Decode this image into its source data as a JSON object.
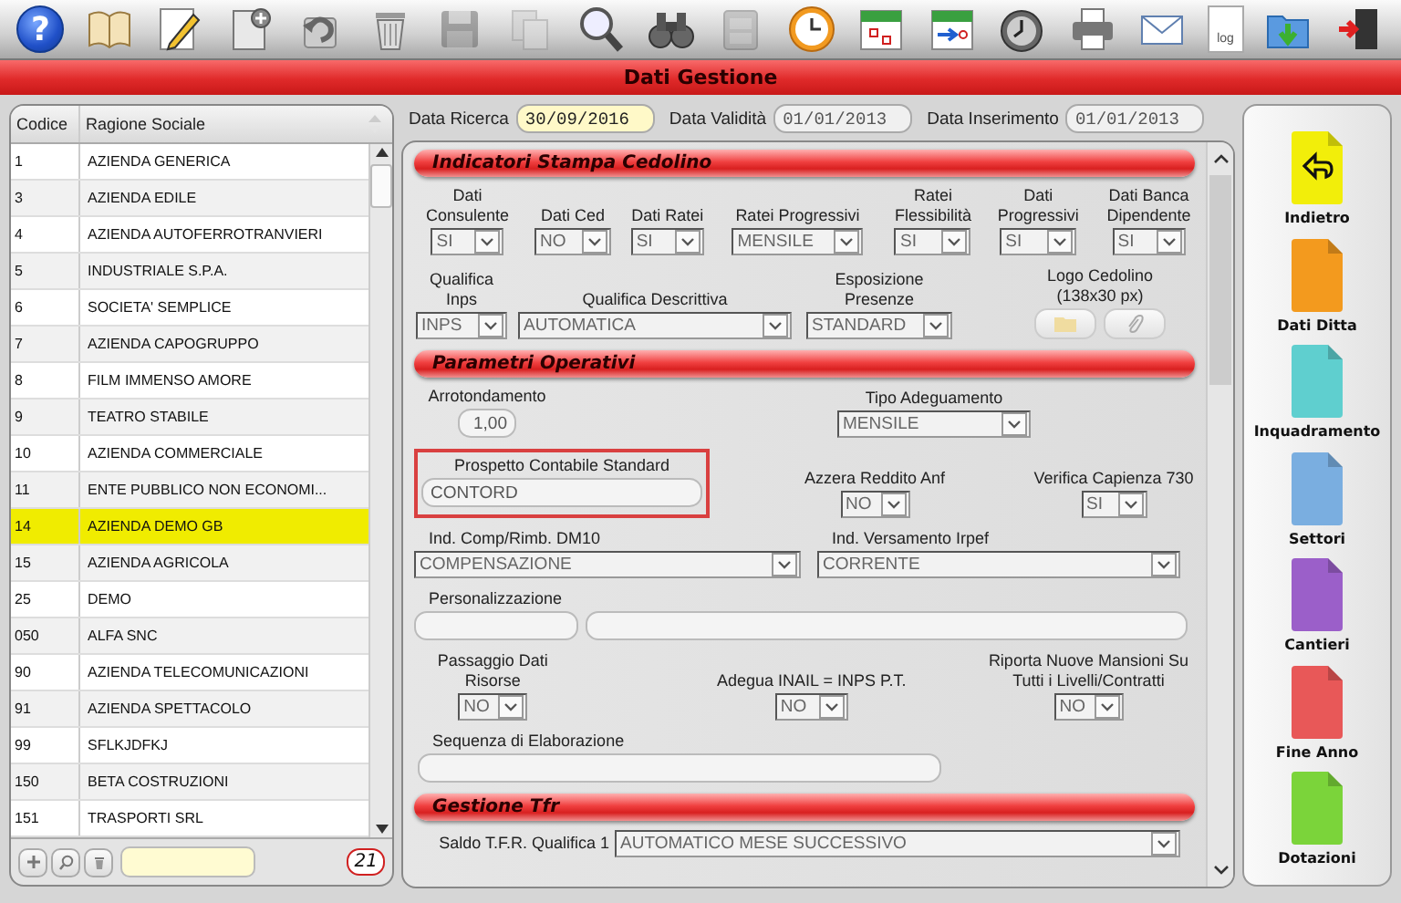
{
  "toolbar": [
    {
      "kind": "help",
      "text": "?",
      "disabled": false
    },
    {
      "kind": "book",
      "disabled": false
    },
    {
      "kind": "edit",
      "disabled": false
    },
    {
      "kind": "new",
      "disabled": false
    },
    {
      "kind": "undo",
      "disabled": false
    },
    {
      "kind": "trash",
      "disabled": false
    },
    {
      "kind": "save",
      "disabled": true
    },
    {
      "kind": "copy",
      "disabled": true
    },
    {
      "kind": "search",
      "disabled": false
    },
    {
      "kind": "binoculars",
      "disabled": false
    },
    {
      "kind": "archive",
      "disabled": true
    },
    {
      "kind": "clock",
      "disabled": false
    },
    {
      "kind": "calendar",
      "disabled": false
    },
    {
      "kind": "calendar-arrow",
      "disabled": false
    },
    {
      "kind": "stopwatch",
      "disabled": false
    },
    {
      "kind": "printer",
      "disabled": false
    },
    {
      "kind": "mail",
      "disabled": false
    },
    {
      "kind": "log",
      "text": "log",
      "disabled": false
    },
    {
      "kind": "folder",
      "disabled": false
    },
    {
      "kind": "exit",
      "disabled": false
    }
  ],
  "title": "Dati Gestione",
  "company_list": {
    "columns": [
      "Codice",
      "Ragione Sociale"
    ],
    "rows": [
      {
        "code": "1",
        "name": "AZIENDA GENERICA",
        "selected": false
      },
      {
        "code": "3",
        "name": "AZIENDA EDILE",
        "selected": false
      },
      {
        "code": "4",
        "name": "AZIENDA AUTOFERROTRANVIERI",
        "selected": false
      },
      {
        "code": "5",
        "name": "INDUSTRIALE S.P.A.",
        "selected": false
      },
      {
        "code": "6",
        "name": "SOCIETA' SEMPLICE",
        "selected": false
      },
      {
        "code": "7",
        "name": "AZIENDA CAPOGRUPPO",
        "selected": false
      },
      {
        "code": "8",
        "name": "FILM IMMENSO AMORE",
        "selected": false
      },
      {
        "code": "9",
        "name": "TEATRO STABILE",
        "selected": false
      },
      {
        "code": "10",
        "name": "AZIENDA COMMERCIALE",
        "selected": false
      },
      {
        "code": "11",
        "name": "ENTE PUBBLICO NON ECONOMI...",
        "selected": false
      },
      {
        "code": "14",
        "name": "AZIENDA DEMO GB",
        "selected": true
      },
      {
        "code": "15",
        "name": "AZIENDA AGRICOLA",
        "selected": false
      },
      {
        "code": "25",
        "name": "DEMO",
        "selected": false
      },
      {
        "code": "050",
        "name": "ALFA SNC",
        "selected": false
      },
      {
        "code": "90",
        "name": "AZIENDA TELECOMUNICAZIONI",
        "selected": false
      },
      {
        "code": "91",
        "name": "AZIENDA SPETTACOLO",
        "selected": false
      },
      {
        "code": "99",
        "name": "SFLKJDFKJ",
        "selected": false
      },
      {
        "code": "150",
        "name": "BETA COSTRUZIONI",
        "selected": false
      },
      {
        "code": "151",
        "name": "TRASPORTI SRL",
        "selected": false
      }
    ],
    "count": "21"
  },
  "dates": [
    {
      "label": "Data Ricerca",
      "value": "30/09/2016",
      "highlighted": true
    },
    {
      "label": "Data Validità",
      "value": "01/01/2013",
      "highlighted": false
    },
    {
      "label": "Data Inserimento",
      "value": "01/01/2013",
      "highlighted": false
    }
  ],
  "sections": [
    {
      "title": "Indicatori Stampa Cedolino",
      "rows": [
        {
          "fields": [
            {
              "kind": "select",
              "label": "Dati Consulente",
              "value": "SI"
            },
            {
              "kind": "select",
              "label": "Dati Ced",
              "value": "NO"
            },
            {
              "kind": "select",
              "label": "Dati Ratei",
              "value": "SI"
            },
            {
              "kind": "select",
              "label": "Ratei Progressivi",
              "value": "MENSILE"
            },
            {
              "kind": "select",
              "label": "Ratei Flessibilità",
              "value": "SI"
            },
            {
              "kind": "select",
              "label": "Dati Progressivi",
              "value": "SI"
            },
            {
              "kind": "select",
              "label": "Dati Banca Dipendente",
              "value": "SI"
            }
          ]
        },
        {
          "fields": [
            {
              "kind": "select",
              "label": "Qualifica Inps",
              "value": "INPS"
            },
            {
              "kind": "select",
              "label": "Qualifica Descrittiva",
              "value": "AUTOMATICA"
            },
            {
              "kind": "select",
              "label": "Esposizione Presenze",
              "value": "STANDARD"
            },
            {
              "kind": "file-buttons",
              "label": "Logo Cedolino (138x30 px)"
            }
          ]
        }
      ]
    },
    {
      "title": "Parametri Operativi",
      "rows": [
        {
          "fields": [
            {
              "kind": "text",
              "label": "Arrotondamento",
              "value": "1,00",
              "highlighted": false
            },
            {
              "kind": "select",
              "label": "Tipo Adeguamento",
              "value": "MENSILE"
            }
          ]
        },
        {
          "fields": [
            {
              "kind": "text",
              "label": "Prospetto Contabile Standard",
              "value": "CONTORD",
              "highlighted": true
            },
            {
              "kind": "select",
              "label": "Azzera Reddito Anf",
              "value": "NO"
            },
            {
              "kind": "select",
              "label": "Verifica Capienza 730",
              "value": "SI"
            }
          ]
        },
        {
          "fields": [
            {
              "kind": "select",
              "label": "Ind. Comp/Rimb. DM10",
              "value": "COMPENSAZIONE"
            },
            {
              "kind": "select",
              "label": "Ind. Versamento Irpef",
              "value": "CORRENTE"
            }
          ]
        },
        {
          "fields": [
            {
              "kind": "text-pair",
              "label": "Personalizzazione"
            }
          ]
        },
        {
          "fields": [
            {
              "kind": "select",
              "label": "Passaggio Dati Risorse",
              "value": "NO"
            },
            {
              "kind": "select",
              "label": "Adegua INAIL = INPS P.T.",
              "value": "NO"
            },
            {
              "kind": "select",
              "label": "Riporta Nuove Mansioni Su Tutti i Livelli/Contratti",
              "value": "NO"
            }
          ]
        },
        {
          "fields": [
            {
              "kind": "text",
              "label": "Sequenza di Elaborazione",
              "highlighted": false
            }
          ]
        }
      ]
    },
    {
      "title": "Gestione Tfr",
      "rows": [
        {
          "fields": [
            {
              "kind": "select-inline",
              "label": "Saldo T.F.R. Qualifica 1",
              "value": "AUTOMATICO MESE SUCCESSIVO"
            }
          ]
        }
      ]
    }
  ],
  "nav": [
    {
      "kind": "back",
      "label": "Indietro",
      "color": "#f2ee0a"
    },
    {
      "kind": "page",
      "label": "Dati Ditta",
      "color": "#f39a1e"
    },
    {
      "kind": "page",
      "label": "Inquadramento",
      "color": "#5fcfcf"
    },
    {
      "kind": "page",
      "label": "Settori",
      "color": "#7aaee0"
    },
    {
      "kind": "page",
      "label": "Cantieri",
      "color": "#9b5fc9"
    },
    {
      "kind": "page",
      "label": "Fine Anno",
      "color": "#e85858"
    },
    {
      "kind": "page",
      "label": "Dotazioni",
      "color": "#7bd43a"
    }
  ]
}
